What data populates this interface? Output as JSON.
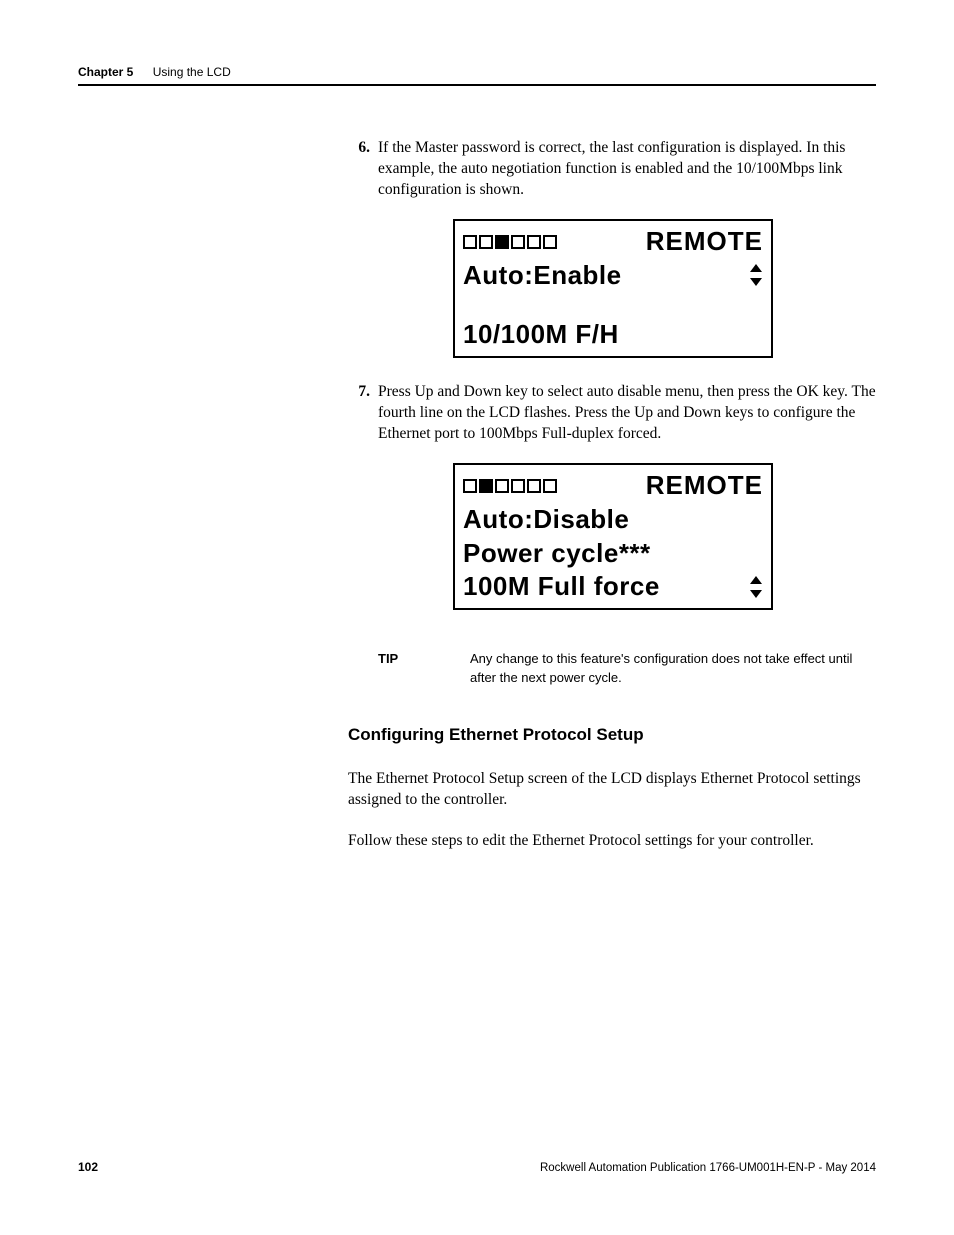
{
  "header": {
    "chapter": "Chapter 5",
    "title": "Using the LCD"
  },
  "steps": [
    {
      "num": "6.",
      "text": "If the Master password is correct, the last configuration is displayed. In this example, the auto negotiation function is enabled and the 10/100Mbps link configuration is shown."
    },
    {
      "num": "7.",
      "text": "Press Up and Down key to select auto disable menu, then press the OK key. The fourth line on the LCD flashes. Press the Up and Down keys to configure the Ethernet port to 100Mbps Full-duplex forced."
    }
  ],
  "lcd1": {
    "io_pattern": [
      0,
      0,
      1,
      0,
      0,
      0
    ],
    "mode": "REMOTE",
    "line2_left": "Auto:Enable",
    "line4": "10/100M F/H"
  },
  "lcd2": {
    "io_pattern": [
      0,
      1,
      0,
      0,
      0,
      0
    ],
    "mode": "REMOTE",
    "line2": "Auto:Disable",
    "line3": "Power cycle***",
    "line4_left": "100M Full force"
  },
  "tip": {
    "label": "TIP",
    "body": "Any change to this feature's configuration does not take effect until after the next power cycle."
  },
  "section_heading": "Configuring Ethernet Protocol Setup",
  "paragraphs": [
    "The Ethernet Protocol Setup screen of the LCD displays Ethernet Protocol settings assigned to the controller.",
    "Follow these steps to edit the Ethernet Protocol settings for your controller."
  ],
  "footer": {
    "page": "102",
    "pub": "Rockwell Automation Publication 1766-UM001H-EN-P - May 2014"
  }
}
